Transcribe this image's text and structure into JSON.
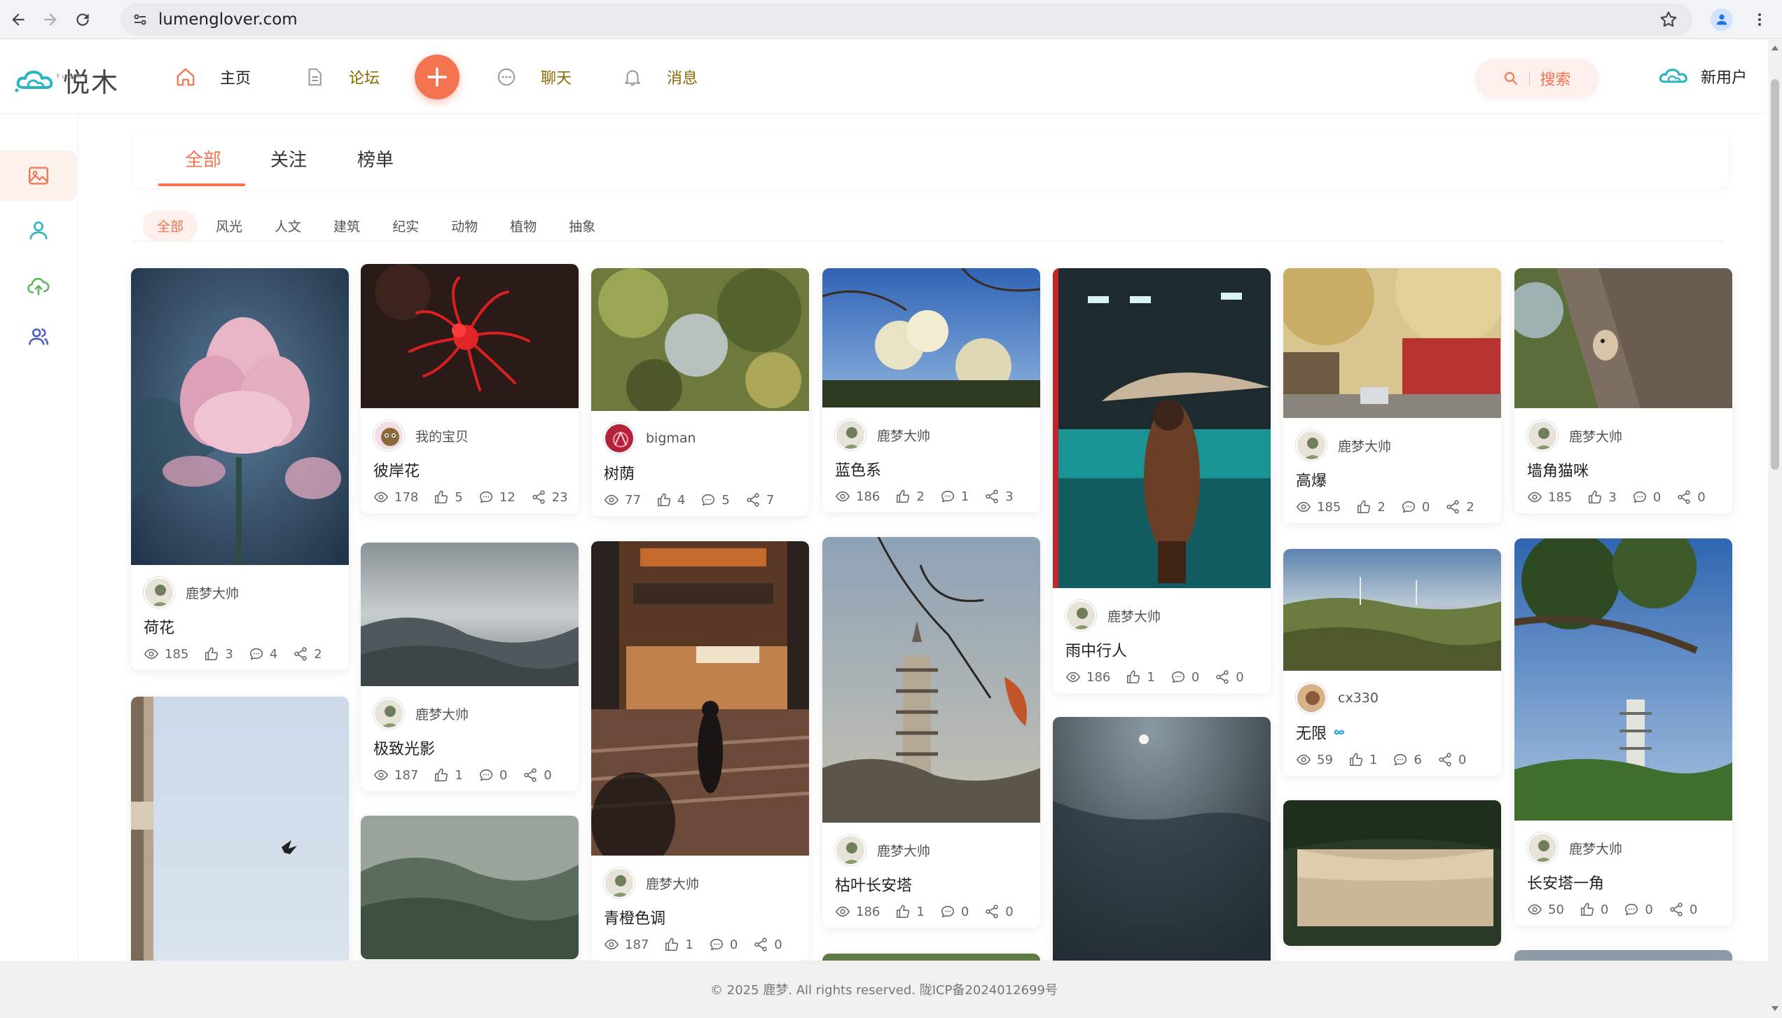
{
  "browser": {
    "url": "lumenglover.com"
  },
  "header": {
    "logo_text": "悦木",
    "logo_sub": "YueMu",
    "nav": {
      "home": "主页",
      "forum": "论坛",
      "chat": "聊天",
      "messages": "消息"
    },
    "search_label": "搜索",
    "user_label": "新用户"
  },
  "tabs": [
    "全部",
    "关注",
    "榜单"
  ],
  "categories": [
    "全部",
    "风光",
    "人文",
    "建筑",
    "纪实",
    "动物",
    "植物",
    "抽象"
  ],
  "cards": [
    {
      "author": "鹿梦大帅",
      "title": "荷花",
      "views": "185",
      "likes": "3",
      "comments": "4",
      "shares": "2"
    },
    {
      "author": "我的宝贝",
      "title": "彼岸花",
      "views": "178",
      "likes": "5",
      "comments": "12",
      "shares": "23"
    },
    {
      "author": "鹿梦大帅",
      "title": "极致光影",
      "views": "187",
      "likes": "1",
      "comments": "0",
      "shares": "0"
    },
    {
      "author": "bigman",
      "title": "树荫",
      "views": "77",
      "likes": "4",
      "comments": "5",
      "shares": "7"
    },
    {
      "author": "鹿梦大帅",
      "title": "青橙色调",
      "views": "187",
      "likes": "1",
      "comments": "0",
      "shares": "0"
    },
    {
      "author": "鹿梦大帅",
      "title": "蓝色系",
      "views": "186",
      "likes": "2",
      "comments": "1",
      "shares": "3"
    },
    {
      "author": "鹿梦大帅",
      "title": "枯叶长安塔",
      "views": "186",
      "likes": "1",
      "comments": "0",
      "shares": "0"
    },
    {
      "author": "鹿梦大帅",
      "title": "雨中行人",
      "views": "186",
      "likes": "1",
      "comments": "0",
      "shares": "0"
    },
    {
      "author": "鹿梦大帅",
      "title": "高爆",
      "views": "185",
      "likes": "2",
      "comments": "0",
      "shares": "2"
    },
    {
      "author": "cx330",
      "title": "无限",
      "views": "59",
      "likes": "1",
      "comments": "6",
      "shares": "0"
    },
    {
      "author": "鹿梦大帅",
      "title": "墙角猫咪",
      "views": "185",
      "likes": "3",
      "comments": "0",
      "shares": "0"
    },
    {
      "author": "鹿梦大帅",
      "title": "长安塔一角",
      "views": "50",
      "likes": "0",
      "comments": "0",
      "shares": "0"
    }
  ],
  "footer": "© 2025 鹿梦. All rights reserved. 陇ICP备2024012699号",
  "colors": {
    "accent": "#f47350",
    "nav_gold": "#8a6a00",
    "logo_teal": "#2bb3c0"
  }
}
